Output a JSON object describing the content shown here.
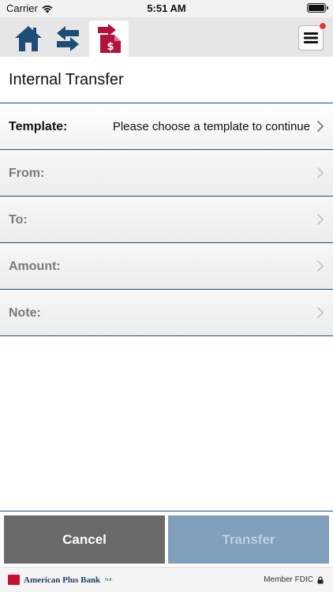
{
  "status_bar": {
    "carrier": "Carrier",
    "time": "5:51 AM",
    "battery_level": 1.0
  },
  "nav": {
    "items": [
      {
        "icon": "home-icon"
      },
      {
        "icon": "swap-arrows-icon"
      },
      {
        "icon": "transfer-dollar-icon",
        "selected": true
      }
    ],
    "menu_icon": "hamburger-menu-icon",
    "menu_has_notification": true
  },
  "page": {
    "title": "Internal Transfer"
  },
  "form": {
    "rows": [
      {
        "label": "Template:",
        "value": "Please choose a template to continue",
        "enabled": true
      },
      {
        "label": "From:",
        "value": "",
        "enabled": false
      },
      {
        "label": "To:",
        "value": "",
        "enabled": false
      },
      {
        "label": "Amount:",
        "value": "",
        "enabled": false
      },
      {
        "label": "Note:",
        "value": "",
        "enabled": false
      }
    ]
  },
  "actions": {
    "cancel_label": "Cancel",
    "transfer_label": "Transfer",
    "transfer_enabled": false
  },
  "footer": {
    "bank_name": "American Plus Bank",
    "bank_suffix": "N.A.",
    "fdic": "Member FDIC"
  },
  "colors": {
    "brand_navy": "#1e4d78",
    "brand_red": "#c8102e",
    "cancel_bg": "#6a6a6a",
    "transfer_disabled_bg": "#7f9fba",
    "badge_red": "#e53935"
  }
}
